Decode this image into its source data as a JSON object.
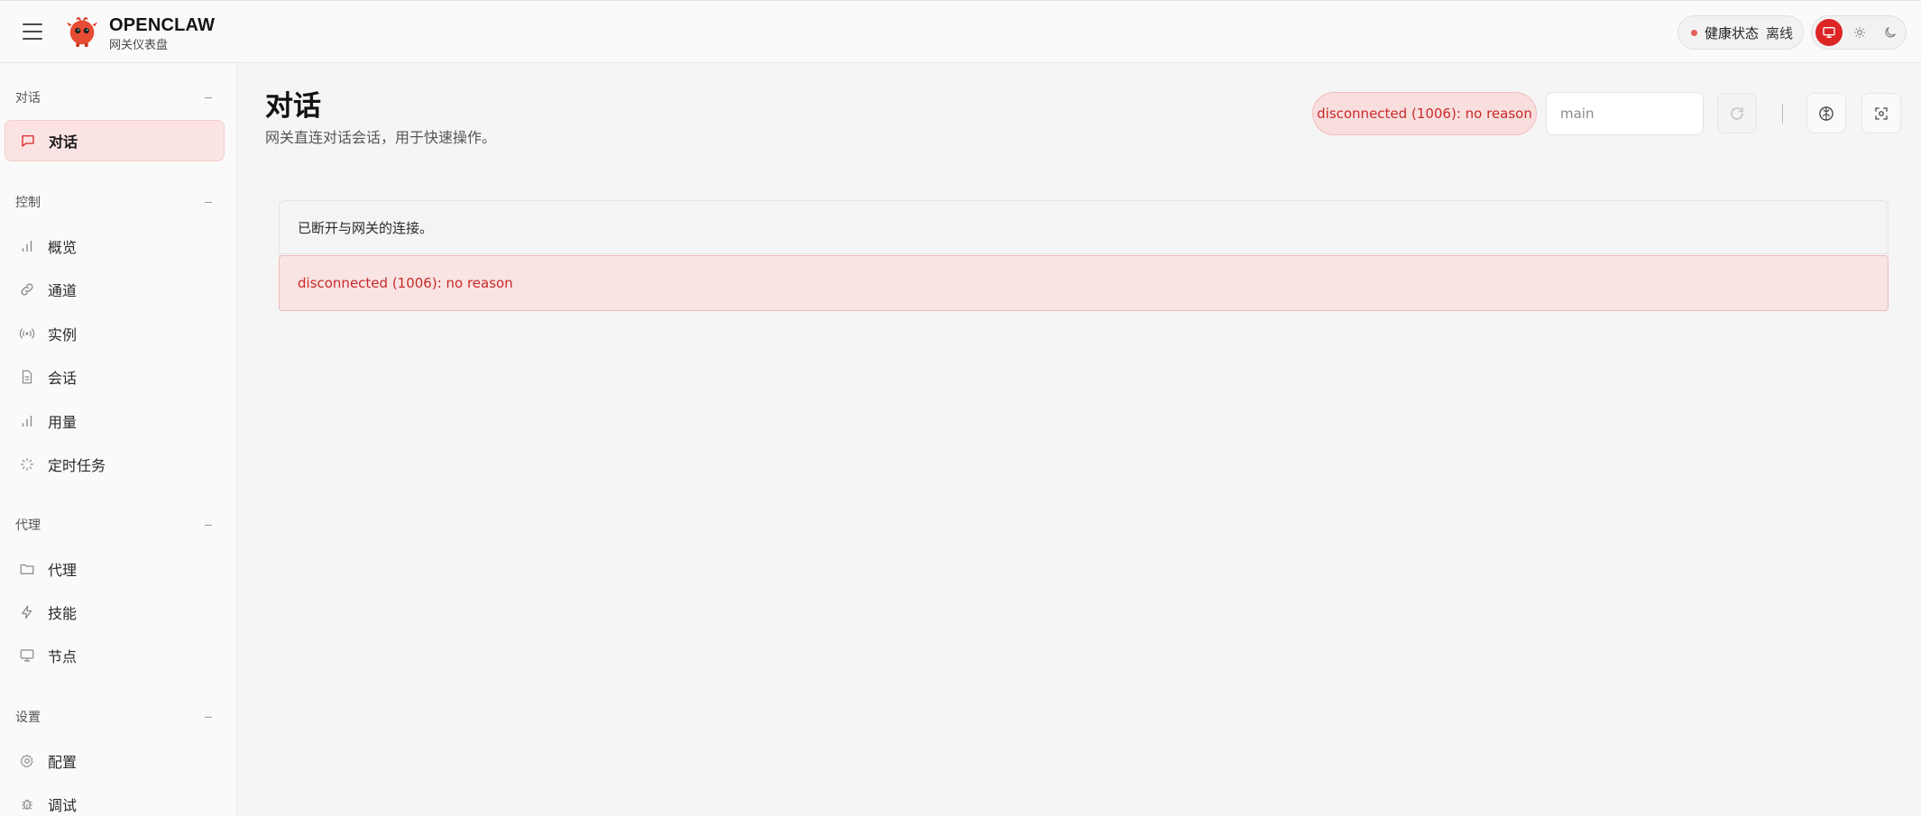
{
  "header": {
    "brand_title": "OPENCLAW",
    "brand_subtitle": "网关仪表盘",
    "health_label": "健康状态",
    "health_value": "离线",
    "colors": {
      "accent": "#dc2626",
      "offline_dot": "#e35d5d"
    }
  },
  "sidebar": {
    "sections": [
      {
        "title": "对话",
        "items": [
          {
            "label": "对话",
            "icon": "message-icon",
            "active": true
          }
        ]
      },
      {
        "title": "控制",
        "items": [
          {
            "label": "概览",
            "icon": "bar-chart-icon"
          },
          {
            "label": "通道",
            "icon": "link-icon"
          },
          {
            "label": "实例",
            "icon": "radio-icon"
          },
          {
            "label": "会话",
            "icon": "document-icon"
          },
          {
            "label": "用量",
            "icon": "bar-chart-icon"
          },
          {
            "label": "定时任务",
            "icon": "loader-icon"
          }
        ]
      },
      {
        "title": "代理",
        "items": [
          {
            "label": "代理",
            "icon": "folder-icon"
          },
          {
            "label": "技能",
            "icon": "lightning-icon"
          },
          {
            "label": "节点",
            "icon": "monitor-icon"
          }
        ]
      },
      {
        "title": "设置",
        "items": [
          {
            "label": "配置",
            "icon": "gear-icon"
          },
          {
            "label": "调试",
            "icon": "bug-icon"
          }
        ]
      }
    ]
  },
  "main": {
    "title": "对话",
    "subtitle": "网关直连对话会话，用于快速操作。",
    "status_chip": "disconnected (1006): no reason",
    "session_input": {
      "value": "",
      "placeholder": "main"
    },
    "notice": "已断开与网关的连接。",
    "error": "disconnected (1006): no reason"
  }
}
